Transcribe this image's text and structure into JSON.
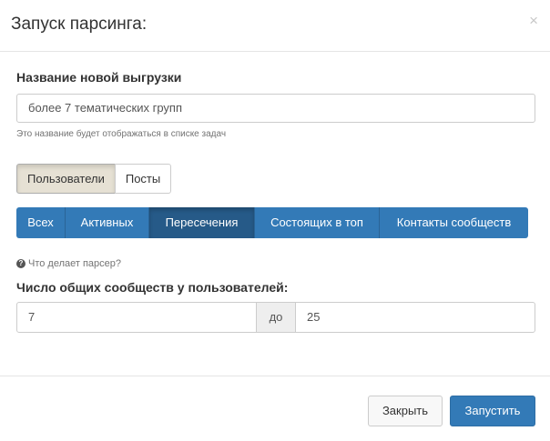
{
  "header": {
    "title": "Запуск парсинга:",
    "close": "×"
  },
  "name_field": {
    "label": "Название новой выгрузки",
    "value": "более 7 тематических групп",
    "help": "Это название будет отображаться в списке задач"
  },
  "type_toggle": [
    {
      "label": "Пользователи",
      "active": true
    },
    {
      "label": "Посты",
      "active": false
    }
  ],
  "mode_tabs": [
    {
      "label": "Всех",
      "active": false
    },
    {
      "label": "Активных",
      "active": false
    },
    {
      "label": "Пересечения",
      "active": true
    },
    {
      "label": "Состоящих в топ",
      "active": false
    },
    {
      "label": "Контакты сообществ",
      "active": false
    }
  ],
  "info_link": {
    "icon": "question-circle-icon",
    "text": "Что делает парсер?"
  },
  "range": {
    "label": "Число общих сообществ у пользователей:",
    "from": "7",
    "separator": "до",
    "to": "25"
  },
  "footer": {
    "close_label": "Закрыть",
    "run_label": "Запустить"
  },
  "colors": {
    "primary": "#337ab7",
    "primary_active": "#265a88",
    "toggle_active": "#e6e1d4"
  }
}
